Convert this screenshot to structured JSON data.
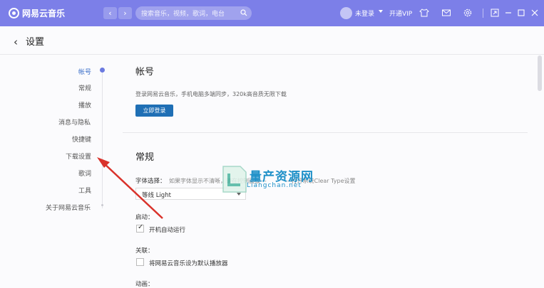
{
  "topbar": {
    "app_name": "网易云音乐",
    "back_glyph": "‹",
    "forward_glyph": "›",
    "search_placeholder": "搜索音乐，视频，歌词，电台",
    "login_label": "未登录",
    "vip_label": "开通VIP",
    "icons": [
      "skin-icon",
      "mail-icon",
      "settings-icon",
      "mini-mode-icon",
      "minimize-icon",
      "maximize-icon",
      "close-icon"
    ]
  },
  "header": {
    "back_glyph": "‹",
    "title": "设置"
  },
  "sidebar": {
    "items": [
      {
        "label": "帐号",
        "active": true
      },
      {
        "label": "常规"
      },
      {
        "label": "播放"
      },
      {
        "label": "消息与隐私"
      },
      {
        "label": "快捷键"
      },
      {
        "label": "下载设置"
      },
      {
        "label": "歌词"
      },
      {
        "label": "工具"
      },
      {
        "label": "关于网易云音乐"
      }
    ]
  },
  "account": {
    "title": "帐号",
    "desc": "登录网易云音乐，手机电脑多端同步，320k高音质无限下载",
    "login_button": "立即登录"
  },
  "general": {
    "title": "常规",
    "font_label": "字体选择：",
    "font_hint": "如果字体显示不清晰，请在控制面板---",
    "font_hint2": "---打开系统Clear Type设置",
    "font_value": "等线 Light",
    "startup_label": "启动：",
    "startup_option": "开机自动运行",
    "assoc_label": "关联：",
    "assoc_option": "将网易云音乐设为默认播放器",
    "anim_label": "动画："
  },
  "watermark": {
    "name": "量产资源网",
    "domain": "Liangchan.net"
  },
  "colors": {
    "topbar": "#7c7fe8",
    "accent": "#1f6fb5",
    "arrow": "#d9322b"
  }
}
